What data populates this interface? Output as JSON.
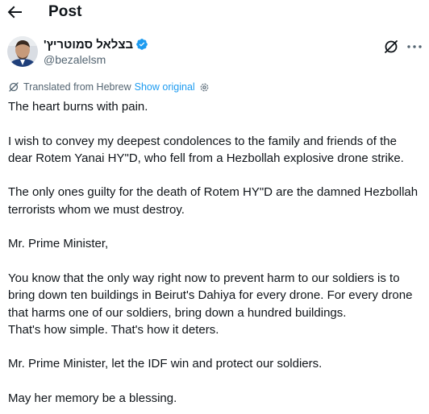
{
  "header": {
    "title": "Post"
  },
  "author": {
    "display_name": "בצלאל סמוטריץ'",
    "handle": "@bezalelsm",
    "verified_color": "#1d9bf0"
  },
  "translation": {
    "label": "Translated from Hebrew",
    "show_original": "Show original"
  },
  "tweet": {
    "paragraphs": [
      "The heart burns with pain.",
      "I wish to convey my deepest condolences to the family and friends of the dear Rotem Yanai HY\"D, who fell from a Hezbollah explosive drone strike.",
      "The only ones guilty for the death of Rotem HY\"D are the damned Hezbollah terrorists whom we must destroy.",
      "Mr. Prime Minister,",
      "You know that the only way right now to prevent harm to our soldiers is to bring down ten buildings in Beirut's Dahiya for every drone. For every drone that harms one of our soldiers, bring down a hundred buildings.",
      "That's how simple. That's how it deters.",
      "Mr. Prime Minister, let the IDF win and protect our soldiers.",
      "May her memory be a blessing."
    ]
  },
  "icons": {
    "back": "arrow-left-icon",
    "verified": "verified-badge-icon",
    "grok": "grok-icon",
    "more": "more-options-icon",
    "translate": "translate-icon",
    "settings": "gear-icon"
  }
}
